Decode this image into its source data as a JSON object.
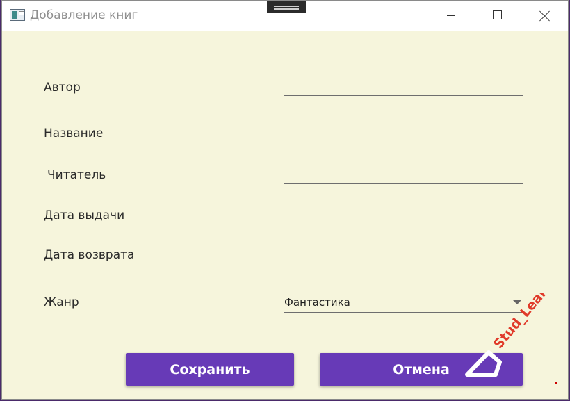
{
  "window": {
    "title": "Добавление книг"
  },
  "form": {
    "fields": [
      {
        "label": "Автор",
        "value": ""
      },
      {
        "label": "Название",
        "value": ""
      },
      {
        "label": "Читатель",
        "value": ""
      },
      {
        "label": "Дата выдачи",
        "value": ""
      },
      {
        "label": "Дата возврата",
        "value": ""
      }
    ],
    "genre": {
      "label": "Жанр",
      "selected": "Фантастика"
    }
  },
  "buttons": {
    "save_label": "Сохранить",
    "cancel_label": "Отмена"
  },
  "watermark": {
    "text": "Stud_Learn"
  },
  "colors": {
    "accent": "#673ab7",
    "background": "#f6f5dc",
    "watermark_red": "#e03a2a"
  },
  "icons": {
    "window_icon": "app-window-icon",
    "minimize": "minimize-icon",
    "maximize": "maximize-icon",
    "close": "close-icon",
    "dropdown": "chevron-down-icon"
  }
}
